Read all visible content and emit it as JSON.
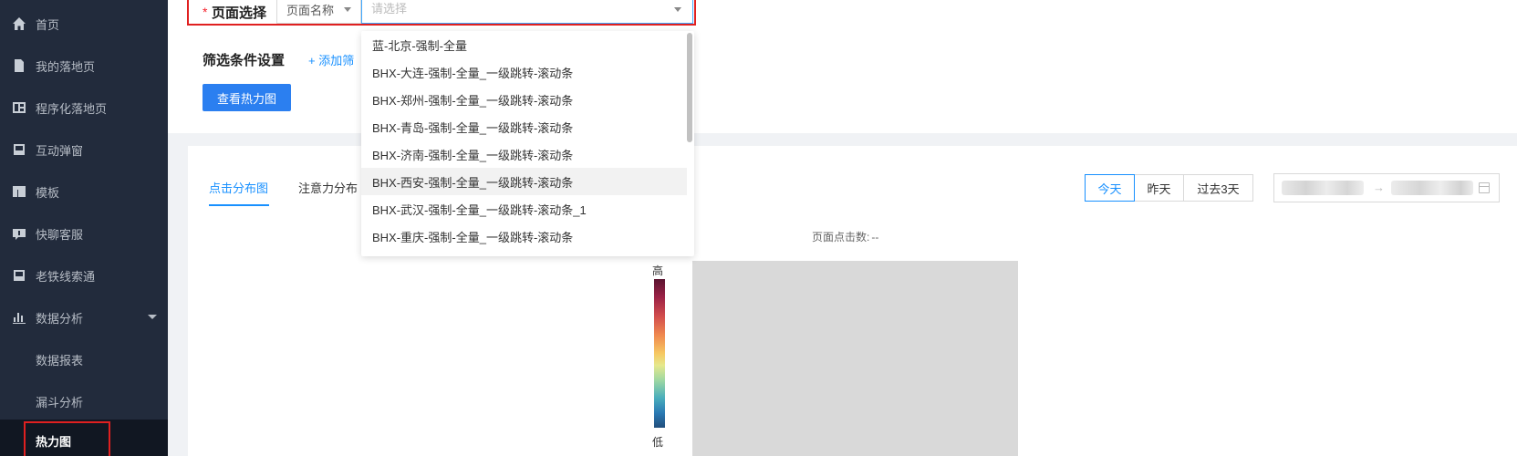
{
  "sidebar": {
    "items": [
      {
        "label": "首页",
        "icon": "home-icon"
      },
      {
        "label": "我的落地页",
        "icon": "document-icon"
      },
      {
        "label": "程序化落地页",
        "icon": "layout-icon"
      },
      {
        "label": "互动弹窗",
        "icon": "popup-icon"
      },
      {
        "label": "模板",
        "icon": "template-icon"
      },
      {
        "label": "快聊客服",
        "icon": "chat-icon"
      },
      {
        "label": "老铁线索通",
        "icon": "leads-icon"
      },
      {
        "label": "数据分析",
        "icon": "bar-chart-icon"
      }
    ],
    "sub_items": [
      {
        "label": "数据报表"
      },
      {
        "label": "漏斗分析"
      },
      {
        "label": "热力图"
      }
    ]
  },
  "page_select": {
    "required_mark": "*",
    "label": "页面选择",
    "type_value": "页面名称",
    "placeholder": "请选择"
  },
  "filter": {
    "label": "筛选条件设置",
    "add_label": "+ 添加筛",
    "view_button": "查看热力图"
  },
  "dropdown": {
    "options": [
      "蓝-北京-强制-全量",
      "BHX-大连-强制-全量_一级跳转-滚动条",
      "BHX-郑州-强制-全量_一级跳转-滚动条",
      "BHX-青岛-强制-全量_一级跳转-滚动条",
      "BHX-济南-强制-全量_一级跳转-滚动条",
      "BHX-西安-强制-全量_一级跳转-滚动条",
      "BHX-武汉-强制-全量_一级跳转-滚动条_1",
      "BHX-重庆-强制-全量_一级跳转-滚动条"
    ],
    "hovered_index": 5
  },
  "tabs": [
    "点击分布图",
    "注意力分布"
  ],
  "range_buttons": [
    "今天",
    "昨天",
    "过去3天"
  ],
  "date_range": {
    "separator": "→"
  },
  "click_count": {
    "label": "页面点击数:",
    "value": "--"
  },
  "legend": {
    "high": "高",
    "low": "低"
  },
  "colors": {
    "sidebar_bg": "#222b3c",
    "accent": "#1890ff",
    "highlight_border": "#e02020",
    "primary_button": "#2b7ff0"
  }
}
